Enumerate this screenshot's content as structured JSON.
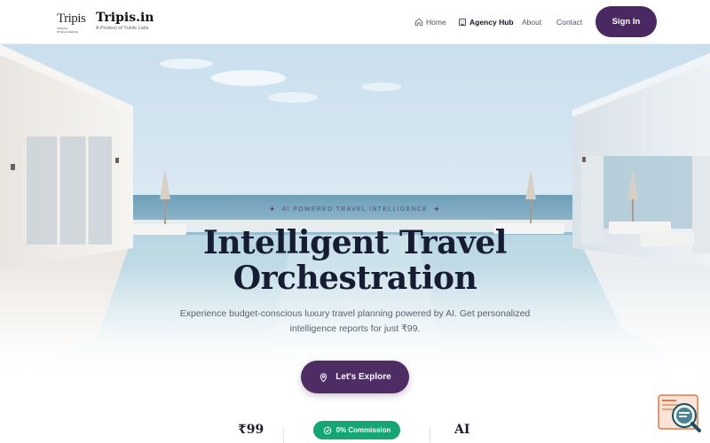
{
  "header": {
    "logo_text": "Tripis",
    "logo_subtext": "TRAVEL INTELLIGENCE",
    "brand_name": "Tripis.in",
    "brand_tagline": "A Product of Yukile Labs",
    "nav": [
      {
        "label": "Home",
        "icon": "home-icon"
      },
      {
        "label": "Agency Hub",
        "icon": "building-icon"
      },
      {
        "label": "About"
      },
      {
        "label": "Contact"
      }
    ],
    "signin_label": "Sign In"
  },
  "hero": {
    "eyebrow": "AI POWERED TRAVEL INTELLIGENCE",
    "title_line1": "Intelligent Travel",
    "title_line2": "Orchestration",
    "subtitle": "Experience budget-conscious luxury travel planning powered by AI. Get personalized intelligence reports for just ₹99.",
    "cta_label": "Let's Explore"
  },
  "stats": {
    "price": "₹99",
    "commission": "0% Commission",
    "ai": "AI"
  },
  "colors": {
    "brand_purple": "#4a2861",
    "commission_green": "#16a673",
    "title_navy": "#161d33"
  }
}
